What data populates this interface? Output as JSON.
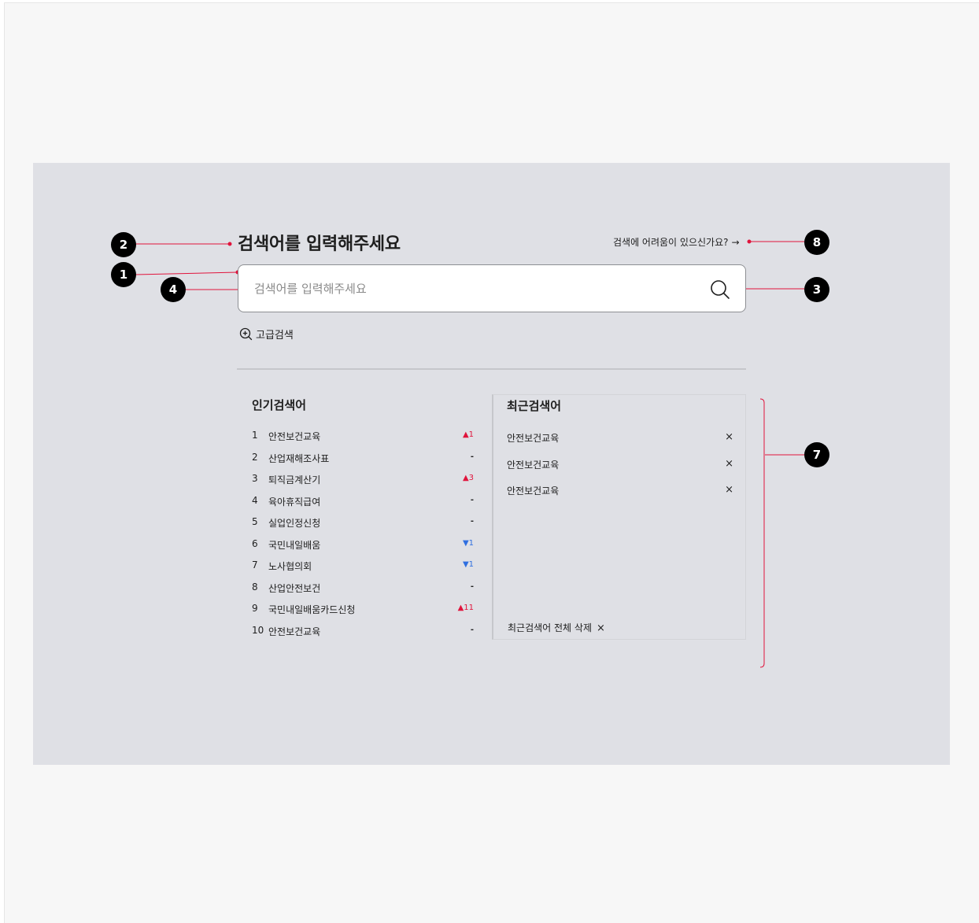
{
  "search_page": {
    "title": "검색어를 입력해주세요",
    "help_link": "검색에 어려움이 있으신가요?",
    "help_arrow": "→",
    "search_input": {
      "placeholder": "검색어를 입력해주세요",
      "value": ""
    },
    "advanced_search_label": "고급검색"
  },
  "popular": {
    "title": "인기검색어",
    "items": [
      {
        "rank": "1",
        "keyword": "안전보건교육",
        "change": "▲1",
        "direction": "up"
      },
      {
        "rank": "2",
        "keyword": "산업재해조사표",
        "change": "-",
        "direction": "same"
      },
      {
        "rank": "3",
        "keyword": "퇴직금계산기",
        "change": "▲3",
        "direction": "up"
      },
      {
        "rank": "4",
        "keyword": "육아휴직급여",
        "change": "-",
        "direction": "same"
      },
      {
        "rank": "5",
        "keyword": "실업인정신청",
        "change": "-",
        "direction": "same"
      },
      {
        "rank": "6",
        "keyword": "국민내일배움",
        "change": "▼1",
        "direction": "down"
      },
      {
        "rank": "7",
        "keyword": "노사협의회",
        "change": "▼1",
        "direction": "down"
      },
      {
        "rank": "8",
        "keyword": "산업안전보건",
        "change": "-",
        "direction": "same"
      },
      {
        "rank": "9",
        "keyword": "국민내일배움카드신청",
        "change": "▲11",
        "direction": "up"
      },
      {
        "rank": "10",
        "keyword": "안전보건교육",
        "change": "-",
        "direction": "same"
      }
    ]
  },
  "recent": {
    "title": "최근검색어",
    "items": [
      {
        "keyword": "안전보건교육",
        "remove": "×"
      },
      {
        "keyword": "안전보건교육",
        "remove": "×"
      },
      {
        "keyword": "안전보건교육",
        "remove": "×"
      }
    ],
    "clear_all_label": "최근검색어 전체 삭제",
    "clear_all_icon": "×"
  },
  "annotations": {
    "markers": [
      "1",
      "2",
      "3",
      "4",
      "7",
      "8"
    ],
    "line_color": "#e0143c"
  },
  "colors": {
    "panel_bg": "#dfe0e5",
    "rank_up": "#e0143c",
    "rank_down": "#2f6fe0"
  },
  "icons": {
    "search": "search-icon",
    "advanced": "zoom-plus-icon",
    "close": "close-icon",
    "arrow": "arrow-right-icon"
  }
}
